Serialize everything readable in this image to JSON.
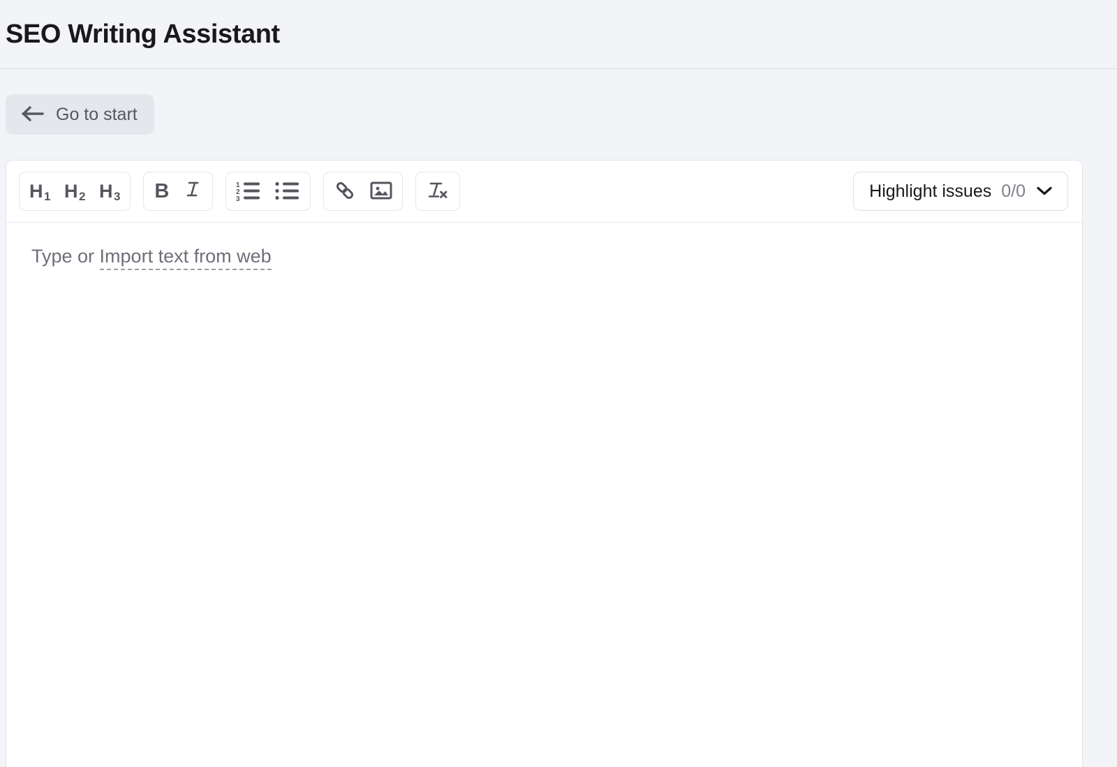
{
  "header": {
    "title": "SEO Writing Assistant"
  },
  "nav": {
    "back_button": {
      "label": "Go to start",
      "icon": "arrow-left-icon"
    }
  },
  "editor": {
    "toolbar": {
      "groups": [
        {
          "name": "headings",
          "buttons": [
            {
              "name": "heading-1-button",
              "letter": "H",
              "sub": "1",
              "icon": "h1-icon"
            },
            {
              "name": "heading-2-button",
              "letter": "H",
              "sub": "2",
              "icon": "h2-icon"
            },
            {
              "name": "heading-3-button",
              "letter": "H",
              "sub": "3",
              "icon": "h3-icon"
            }
          ]
        },
        {
          "name": "text-style",
          "buttons": [
            {
              "name": "bold-button",
              "letter": "B",
              "icon": "bold-icon"
            },
            {
              "name": "italic-button",
              "letter": "I",
              "icon": "italic-icon"
            }
          ]
        },
        {
          "name": "lists",
          "buttons": [
            {
              "name": "ordered-list-button",
              "icon": "ordered-list-icon"
            },
            {
              "name": "bullet-list-button",
              "icon": "bullet-list-icon"
            }
          ]
        },
        {
          "name": "insert",
          "buttons": [
            {
              "name": "insert-link-button",
              "icon": "link-icon"
            },
            {
              "name": "insert-image-button",
              "icon": "image-icon"
            }
          ]
        },
        {
          "name": "clear",
          "buttons": [
            {
              "name": "clear-formatting-button",
              "icon": "clear-formatting-icon"
            }
          ]
        }
      ],
      "highlight_issues": {
        "label": "Highlight issues",
        "count": "0/0",
        "icon": "chevron-down-icon"
      }
    },
    "content": {
      "placeholder_prefix": "Type or ",
      "placeholder_link": "Import text from web",
      "value": ""
    }
  },
  "colors": {
    "page_background": "#f3f4f7",
    "panel_background": "#ffffff",
    "title_text": "#19191d",
    "muted_text": "#6e6f78",
    "icon_gray": "#55555e",
    "border": "#e3e4e9",
    "button_background": "#e6e7ec"
  }
}
